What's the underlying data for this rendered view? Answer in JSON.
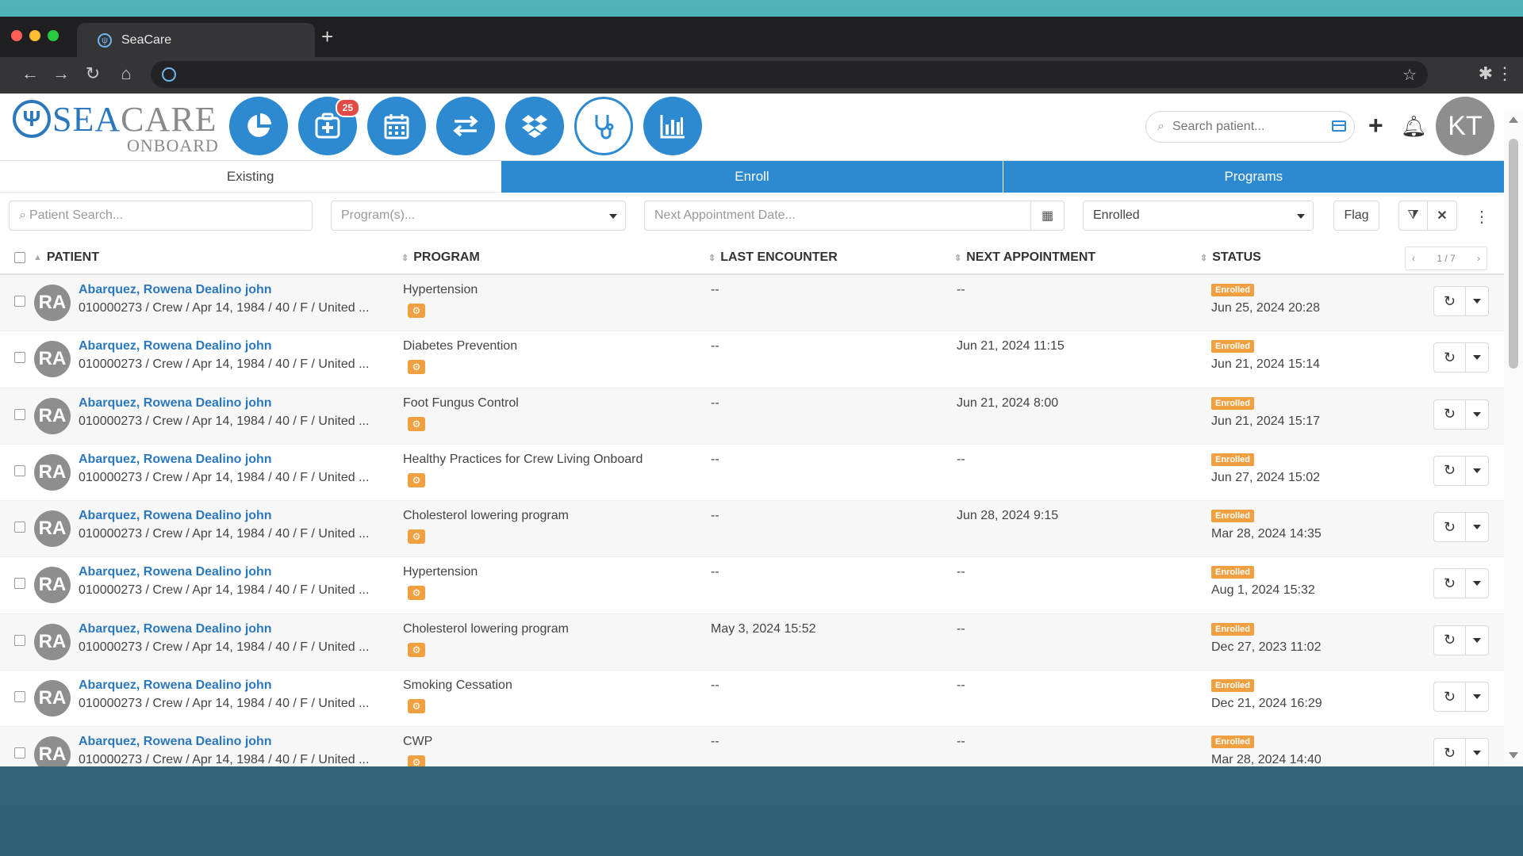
{
  "browser": {
    "tab_title": "SeaCare",
    "new_tab": "+"
  },
  "logo": {
    "sea": "SEA",
    "care": "CARE",
    "sub": "ONBOARD"
  },
  "header": {
    "notification_count": "25",
    "search_placeholder": "Search patient...",
    "avatar_initials": "KT",
    "icons": [
      "dashboard-pie-icon",
      "add-medical-icon",
      "calendar-icon",
      "transfer-icon",
      "dropbox-icon",
      "stethoscope-icon",
      "bar-chart-icon"
    ]
  },
  "tabs": [
    {
      "label": "Existing"
    },
    {
      "label": "Enroll"
    },
    {
      "label": "Programs"
    }
  ],
  "filters": {
    "patient_search_placeholder": "Patient Search...",
    "programs_placeholder": "Program(s)...",
    "next_appt_placeholder": "Next Appointment Date...",
    "status_value": "Enrolled",
    "flag_label": "Flag"
  },
  "table": {
    "headers": {
      "patient": "PATIENT",
      "program": "PROGRAM",
      "last_encounter": "LAST ENCOUNTER",
      "next_appointment": "NEXT APPOINTMENT",
      "status": "STATUS"
    },
    "pager": "1 / 7",
    "rows": [
      {
        "initials": "RA",
        "name": "Abarquez, Rowena Dealino john",
        "detail": "010000273 / Crew / Apr 14, 1984 / 40 / F / United ...",
        "program": "Hypertension",
        "last": "--",
        "next": "--",
        "status": "Enrolled",
        "status_date": "Jun 25, 2024 20:28"
      },
      {
        "initials": "RA",
        "name": "Abarquez, Rowena Dealino john",
        "detail": "010000273 / Crew / Apr 14, 1984 / 40 / F / United ...",
        "program": "Diabetes Prevention",
        "last": "--",
        "next": "Jun 21, 2024 11:15",
        "status": "Enrolled",
        "status_date": "Jun 21, 2024 15:14"
      },
      {
        "initials": "RA",
        "name": "Abarquez, Rowena Dealino john",
        "detail": "010000273 / Crew / Apr 14, 1984 / 40 / F / United ...",
        "program": "Foot Fungus Control",
        "last": "--",
        "next": "Jun 21, 2024 8:00",
        "status": "Enrolled",
        "status_date": "Jun 21, 2024 15:17"
      },
      {
        "initials": "RA",
        "name": "Abarquez, Rowena Dealino john",
        "detail": "010000273 / Crew / Apr 14, 1984 / 40 / F / United ...",
        "program": "Healthy Practices for Crew Living Onboard",
        "last": "--",
        "next": "--",
        "status": "Enrolled",
        "status_date": "Jun 27, 2024 15:02"
      },
      {
        "initials": "RA",
        "name": "Abarquez, Rowena Dealino john",
        "detail": "010000273 / Crew / Apr 14, 1984 / 40 / F / United ...",
        "program": "Cholesterol lowering program",
        "last": "--",
        "next": "Jun 28, 2024 9:15",
        "status": "Enrolled",
        "status_date": "Mar 28, 2024 14:35"
      },
      {
        "initials": "RA",
        "name": "Abarquez, Rowena Dealino john",
        "detail": "010000273 / Crew / Apr 14, 1984 / 40 / F / United ...",
        "program": "Hypertension",
        "last": "--",
        "next": "--",
        "status": "Enrolled",
        "status_date": "Aug 1, 2024 15:32"
      },
      {
        "initials": "RA",
        "name": "Abarquez, Rowena Dealino john",
        "detail": "010000273 / Crew / Apr 14, 1984 / 40 / F / United ...",
        "program": "Cholesterol lowering program",
        "last": "May 3, 2024 15:52",
        "next": "--",
        "status": "Enrolled",
        "status_date": "Dec 27, 2023 11:02"
      },
      {
        "initials": "RA",
        "name": "Abarquez, Rowena Dealino john",
        "detail": "010000273 / Crew / Apr 14, 1984 / 40 / F / United ...",
        "program": "Smoking Cessation",
        "last": "--",
        "next": "--",
        "status": "Enrolled",
        "status_date": "Dec 21, 2024 16:29"
      },
      {
        "initials": "RA",
        "name": "Abarquez, Rowena Dealino john",
        "detail": "010000273 / Crew / Apr 14, 1984 / 40 / F / United ...",
        "program": "CWP",
        "last": "--",
        "next": "--",
        "status": "Enrolled",
        "status_date": "Mar 28, 2024 14:40"
      }
    ]
  },
  "colors": {
    "primary": "#2d8ad1",
    "status_enrolled": "#f0a040",
    "avatar_bg": "#8e8e8e",
    "link": "#2c78bd"
  }
}
